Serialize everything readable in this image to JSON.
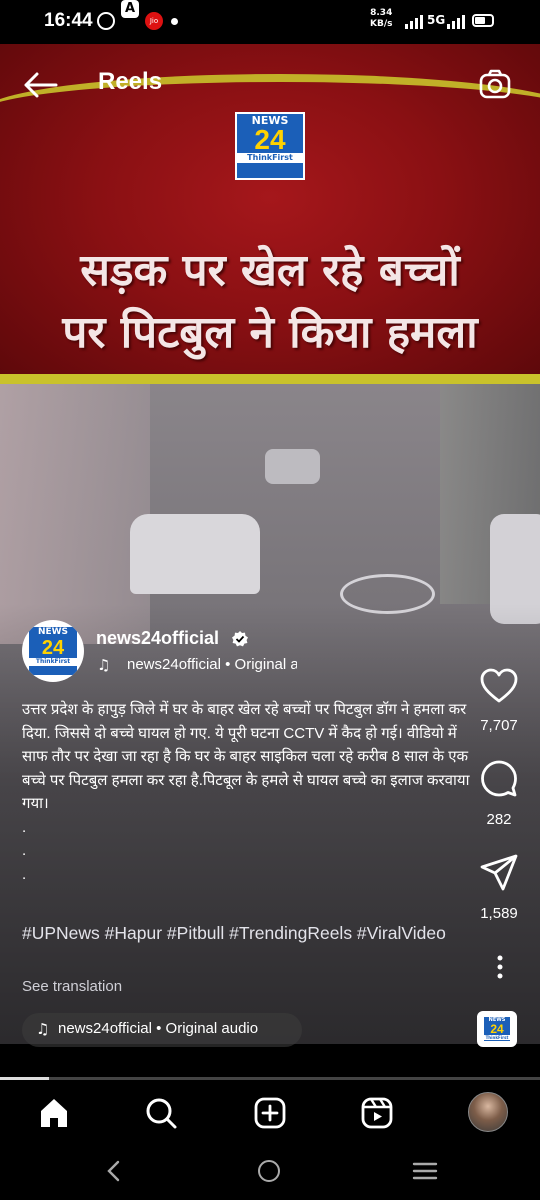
{
  "status_bar": {
    "time": "16:44",
    "jio_label": "Jio",
    "net_speed_value": "8.34",
    "net_speed_unit": "KB/s",
    "network": "5G"
  },
  "header": {
    "title": "Reels"
  },
  "video": {
    "logo": {
      "line1": "NEWS",
      "line2": "24",
      "line3": "ThinkFirst"
    },
    "headline_line1": "सड़क पर खेल रहे बच्चों",
    "headline_line2": "पर पिटबुल ने किया हमला",
    "progress_fraction": 0.09
  },
  "author": {
    "name": "news24official",
    "audio_line": "news24official • Original audio"
  },
  "caption": {
    "text": "उत्तर प्रदेश के हापुड़ जिले में घर के बाहर खेल रहे बच्चों पर पिटबुल डॉग ने हमला कर दिया. जिससे दो बच्चे घायल हो गए. ये पूरी घटना CCTV में कैद हो गई। वीडियो में साफ तौर पर देखा जा रहा है कि घर के बाहर साइकिल चला रहे करीब 8 साल के एक बच्चे पर पिटबुल हमला कर रहा है.पिटबूल के हमले से घायल बच्चे का इलाज करवाया गया।",
    "dots": [
      ".",
      ".",
      "."
    ],
    "hashtags": "#UPNews #Hapur #Pitbull #TrendingReels #ViralVideo",
    "see_translation": "See translation"
  },
  "audio_pill": {
    "label": "news24official • Original audio"
  },
  "actions": {
    "likes": "7,707",
    "comments": "282",
    "shares": "1,589"
  },
  "bottom_nav": {
    "icons": [
      "home-icon",
      "search-icon",
      "create-icon",
      "reels-icon",
      "profile-avatar"
    ]
  },
  "colors": {
    "banner_red": "#8a1013",
    "banner_yellow": "#c9c22b",
    "logo_blue": "#1b5fb8"
  }
}
